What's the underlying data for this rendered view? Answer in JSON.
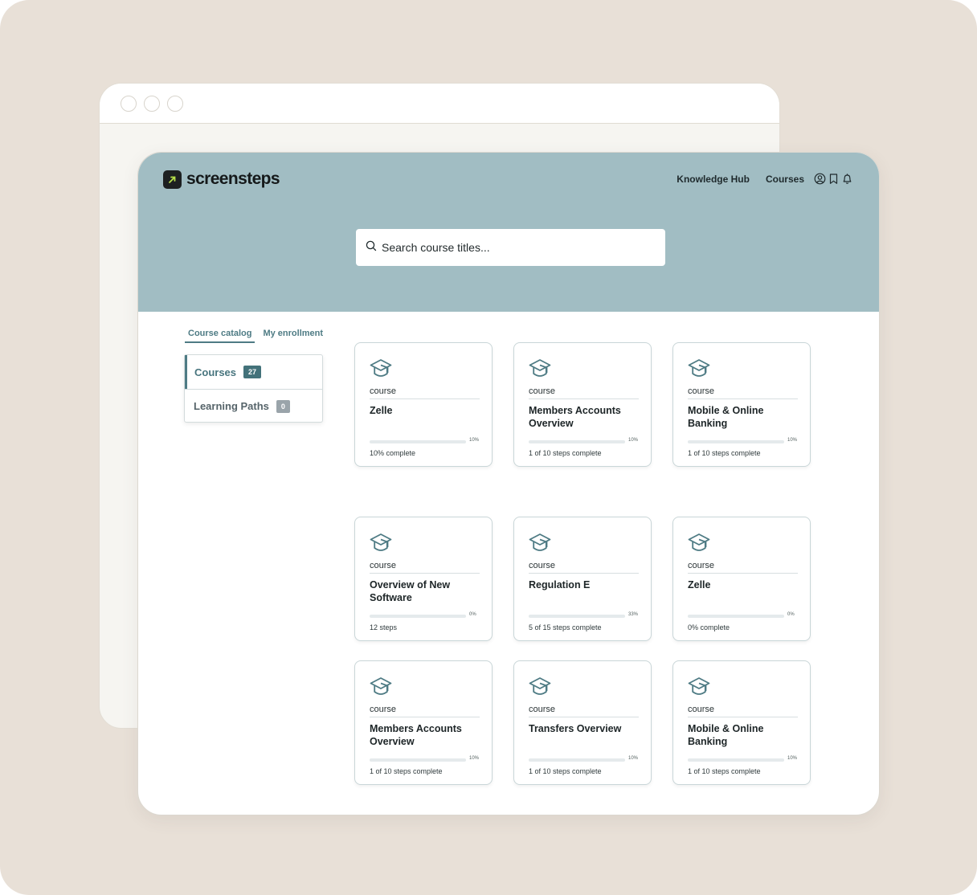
{
  "header": {
    "logo_text": "screensteps",
    "nav": [
      "Knowledge Hub",
      "Courses"
    ],
    "icons": [
      "user-icon",
      "bookmark-icon",
      "bell-icon"
    ]
  },
  "search": {
    "placeholder": "Search course titles..."
  },
  "tabs": [
    {
      "label": "Course catalog",
      "active": true
    },
    {
      "label": "My enrollment",
      "active": false
    }
  ],
  "sidebar": {
    "items": [
      {
        "label": "Courses",
        "count": "27",
        "active": true
      },
      {
        "label": "Learning Paths",
        "count": "0",
        "active": false
      }
    ]
  },
  "cards": [
    {
      "type": "course",
      "title": "Zelle",
      "progress_pct": 10,
      "pct_label": "10%",
      "status": "10% complete"
    },
    {
      "type": "course",
      "title": "Members Accounts Overview",
      "progress_pct": 10,
      "pct_label": "10%",
      "status": "1 of 10 steps complete"
    },
    {
      "type": "course",
      "title": "Mobile & Online Banking",
      "progress_pct": 10,
      "pct_label": "10%",
      "status": "1 of 10 steps complete"
    },
    {
      "type": "course",
      "title": "Overview of New Software",
      "progress_pct": 0,
      "pct_label": "0%",
      "status": "12 steps"
    },
    {
      "type": "course",
      "title": "Regulation E",
      "progress_pct": 8,
      "pct_label": "33%",
      "status": "5 of 15 steps complete"
    },
    {
      "type": "course",
      "title": "Zelle",
      "progress_pct": 0,
      "pct_label": "0%",
      "status": "0% complete"
    },
    {
      "type": "course",
      "title": "Members Accounts Overview",
      "progress_pct": 10,
      "pct_label": "10%",
      "status": "1 of 10 steps complete"
    },
    {
      "type": "course",
      "title": "Transfers Overview",
      "progress_pct": 10,
      "pct_label": "10%",
      "status": "1 of 10 steps complete"
    },
    {
      "type": "course",
      "title": "Mobile & Online Banking",
      "progress_pct": 10,
      "pct_label": "10%",
      "status": "1 of 10 steps complete"
    }
  ],
  "colors": {
    "hero": "#a1bdc3",
    "accent": "#4e7b84",
    "progress": "#36686f",
    "backdrop": "#e8e0d7"
  }
}
